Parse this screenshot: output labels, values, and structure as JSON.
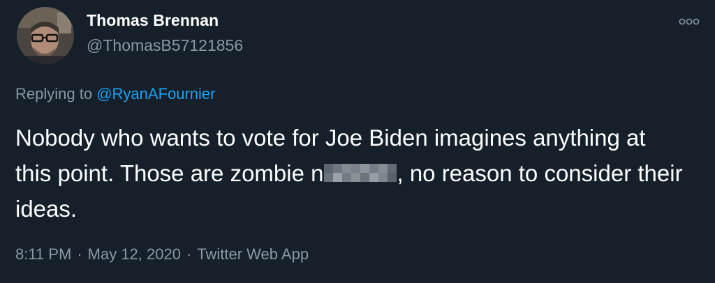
{
  "author": {
    "name": "Thomas Brennan",
    "handle": "@ThomasB57121856"
  },
  "reply": {
    "prefix": "Replying to",
    "mention": "@RyanAFournier"
  },
  "tweet": {
    "text_part1": "Nobody who wants to vote for Joe Biden imagines anything at this point. Those are zombie n",
    "text_part2": ", no reason to consider their ideas."
  },
  "meta": {
    "time": "8:11 PM",
    "date": "May 12, 2020",
    "source": "Twitter Web App",
    "separator": "·"
  },
  "icons": {
    "more": "more-options-icon",
    "censor": "pixelated-censor-icon"
  },
  "colors": {
    "background": "#15202b",
    "primary_text": "#ffffff",
    "secondary_text": "#8899a6",
    "link": "#1da1f2"
  }
}
